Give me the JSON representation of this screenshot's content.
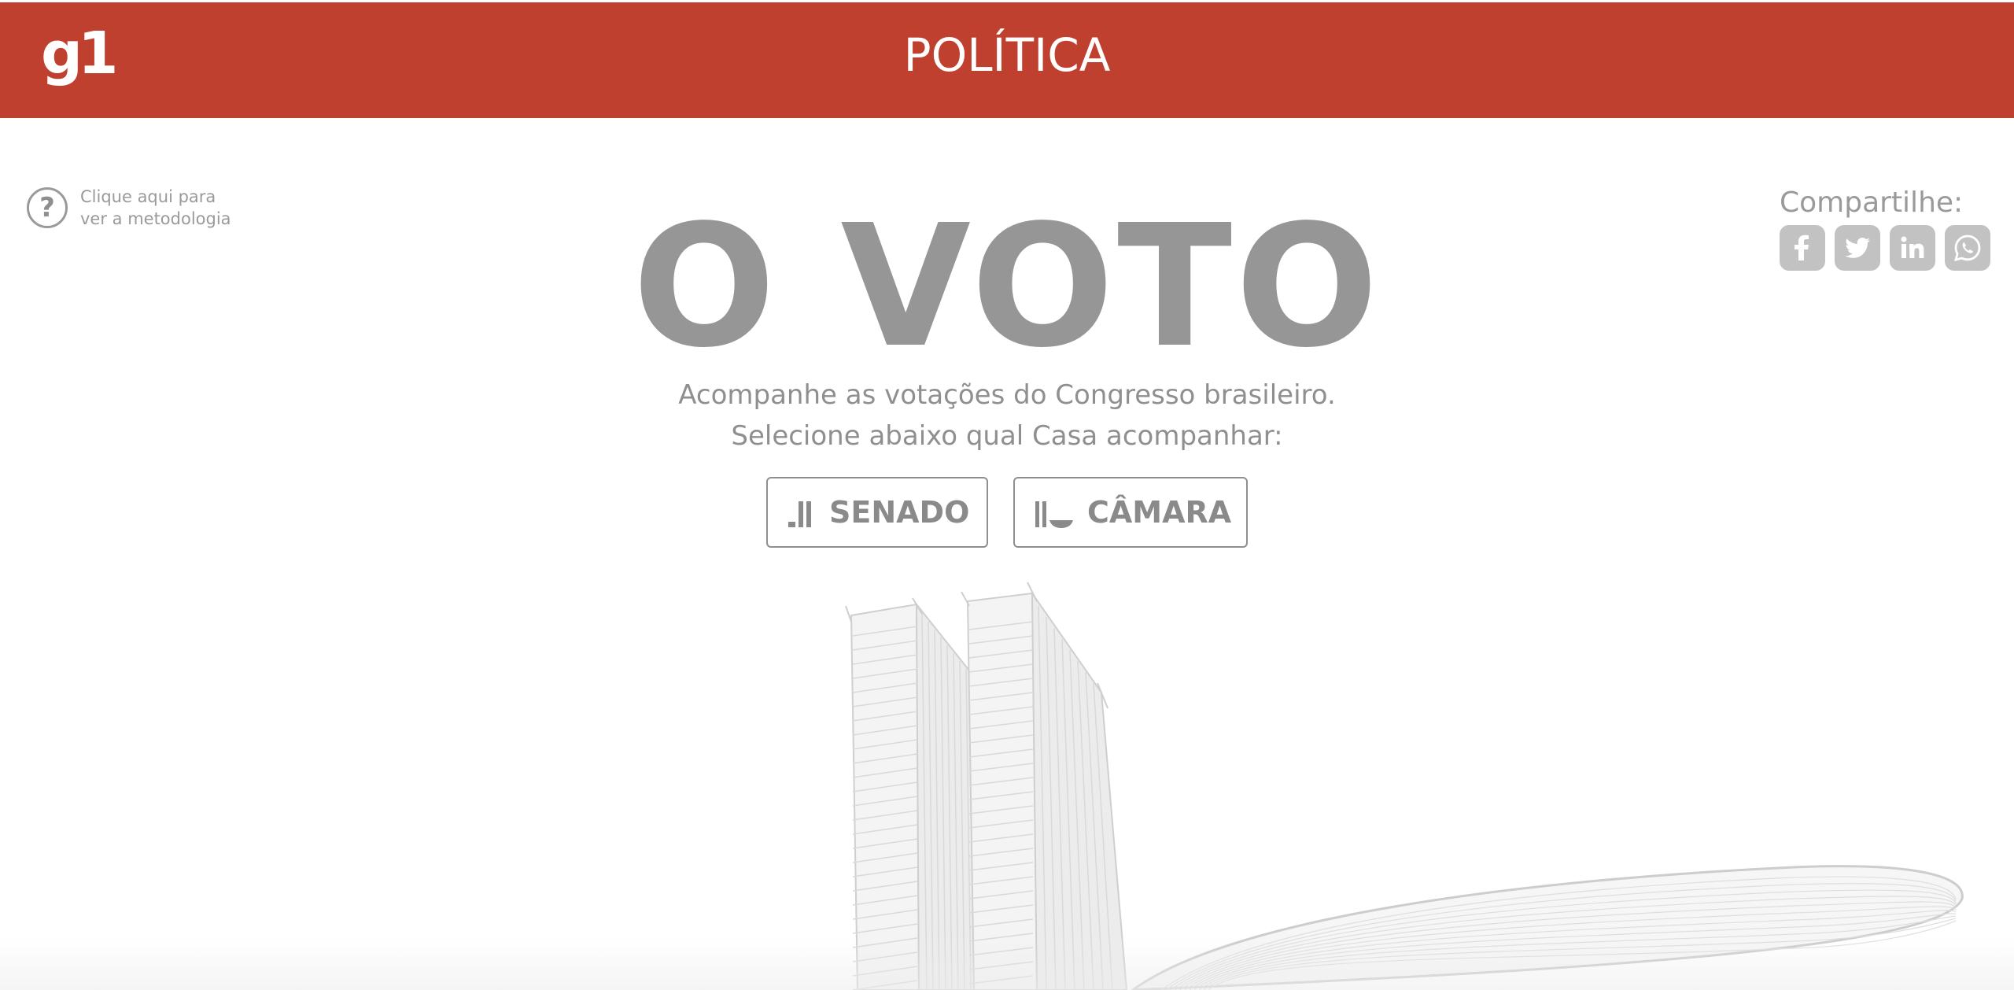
{
  "header": {
    "logo": "g1",
    "section": "POLÍTICA"
  },
  "methodology": {
    "line1": "Clique aqui para",
    "line2": "ver a metodologia",
    "icon": "question-circle-icon"
  },
  "share": {
    "label": "Compartilhe:",
    "networks": [
      "facebook",
      "twitter",
      "linkedin",
      "whatsapp"
    ]
  },
  "hero": {
    "title": "O VOTO",
    "subtitle_line1": "Acompanhe as votações do Congresso brasileiro.",
    "subtitle_line2": "Selecione abaixo qual Casa acompanhar:"
  },
  "houses": {
    "senado_label": "SENADO",
    "camara_label": "CÂMARA"
  },
  "colors": {
    "header_bg": "#c0402f",
    "text_gray": "#8f8f8f",
    "title_gray": "#969696",
    "icon_gray": "#c2c2c2"
  }
}
